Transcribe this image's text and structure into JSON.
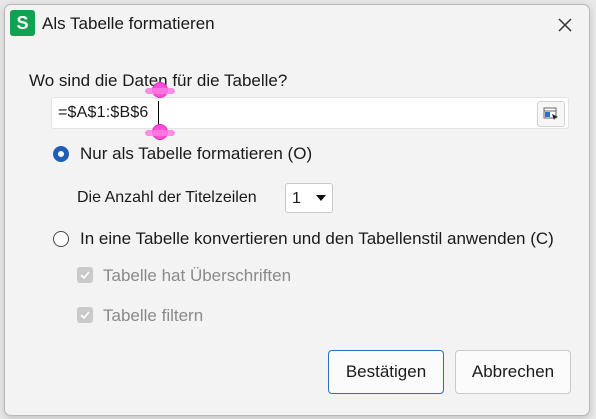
{
  "window": {
    "app_icon_letter": "S",
    "title": "Als Tabelle formatieren",
    "accent_color": "#1f5fb8",
    "app_icon_color": "#12a150"
  },
  "form": {
    "question": "Wo sind die Daten für die Tabelle?",
    "range_value": "=$A$1:$B$6",
    "options": [
      {
        "label": "Nur als Tabelle formatieren (O)",
        "checked": true
      },
      {
        "label": "In eine Tabelle konvertieren und den Tabellenstil anwenden (C)",
        "checked": false
      }
    ],
    "title_rows_label": "Die Anzahl der Titelzeilen",
    "title_rows_value": "1",
    "checkboxes": [
      {
        "label": "Tabelle hat Überschriften",
        "checked": true,
        "disabled": true
      },
      {
        "label": "Tabelle filtern",
        "checked": true,
        "disabled": true
      }
    ]
  },
  "buttons": {
    "confirm": "Bestätigen",
    "cancel": "Abbrechen"
  }
}
